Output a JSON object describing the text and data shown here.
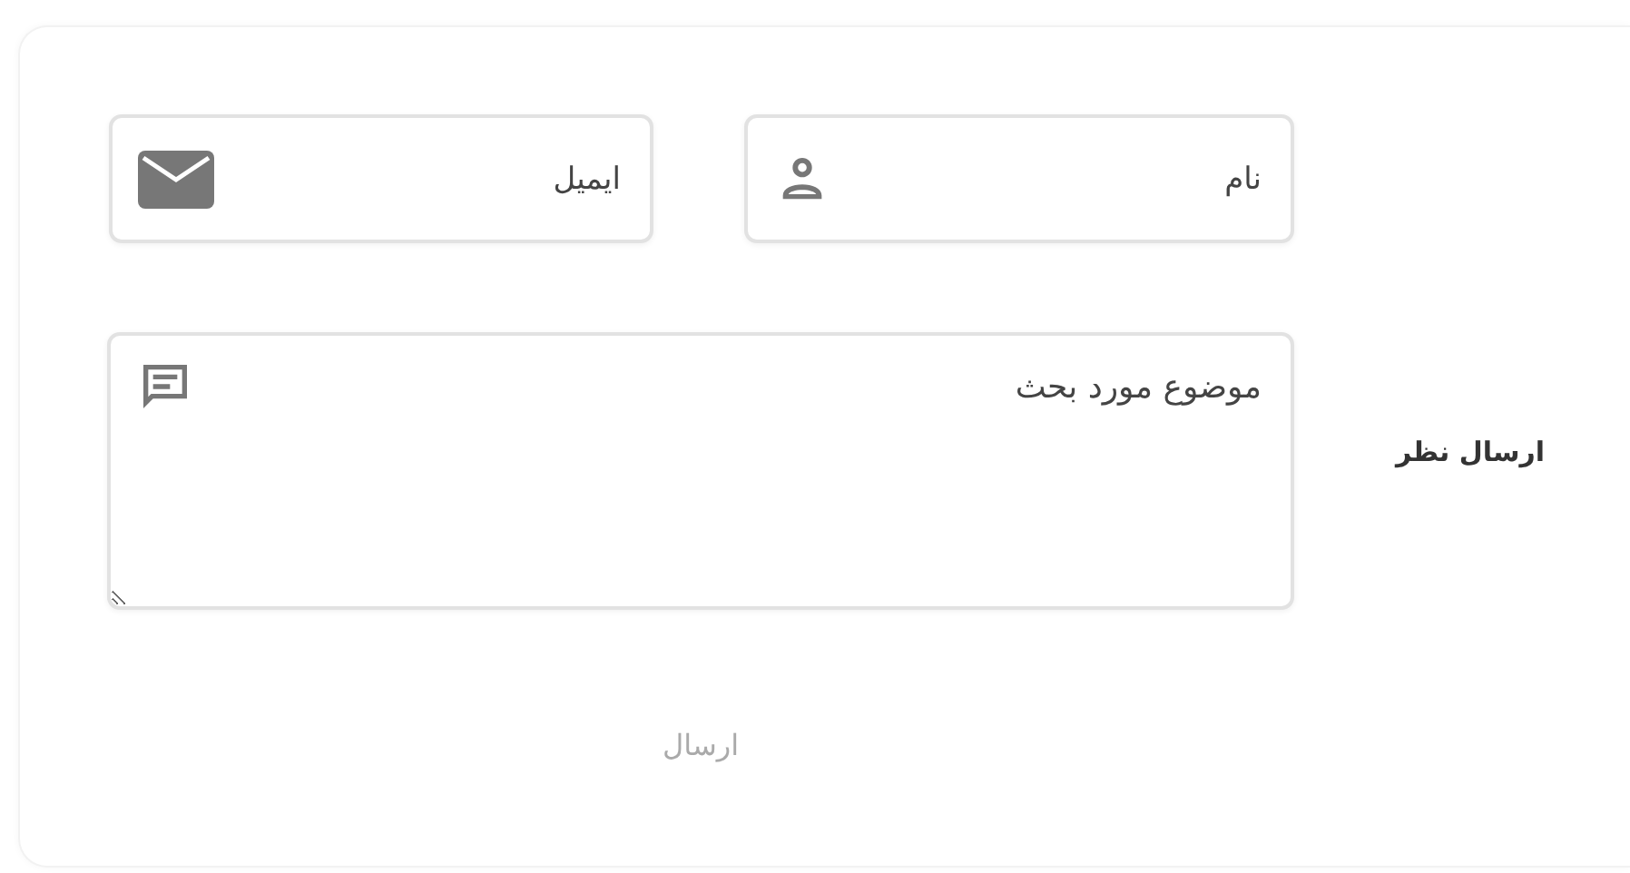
{
  "form": {
    "fields": [
      {
        "kind": "name",
        "placeholder": "نام"
      },
      {
        "kind": "email",
        "placeholder": "ایمیل"
      }
    ],
    "message": {
      "placeholder": "موضوع مورد بحث"
    },
    "label": "ارسال نظر",
    "submit": "ارسال"
  }
}
